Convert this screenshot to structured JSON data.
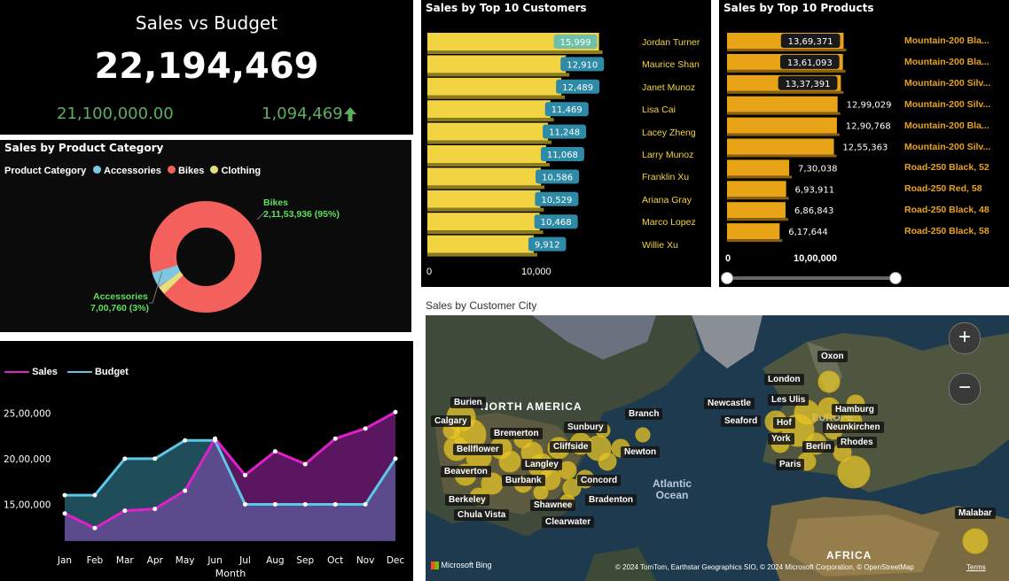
{
  "kpi": {
    "title": "Sales vs Budget",
    "value": "22,194,469",
    "budget": "21,100,000.00",
    "variance": "1,094,469",
    "variance_icon": "arrow-up-icon",
    "color_positive": "#5fae5f"
  },
  "category": {
    "title": "Sales by Product Category",
    "legend_title": "Product Category",
    "legend": [
      {
        "name": "Accessories",
        "color": "#7ec8e3"
      },
      {
        "name": "Bikes",
        "color": "#f4605c"
      },
      {
        "name": "Clothing",
        "color": "#e6e07a"
      }
    ],
    "bikes_label": "Bikes",
    "bikes_value": "2,11,53,936 (95%)",
    "acc_label": "Accessories",
    "acc_value": "7,00,760 (3%)"
  },
  "customers": {
    "title": "Sales by Top 10 Customers",
    "axis_0": "0",
    "axis_1": "10,000",
    "color": "#f2d342",
    "items": [
      {
        "name": "Jordan Turner",
        "label": "15,999"
      },
      {
        "name": "Maurice Shan",
        "label": "12,910"
      },
      {
        "name": "Janet Munoz",
        "label": "12,489"
      },
      {
        "name": "Lisa Cai",
        "label": "11,469"
      },
      {
        "name": "Lacey Zheng",
        "label": "11,248"
      },
      {
        "name": "Larry Munoz",
        "label": "11,068"
      },
      {
        "name": "Franklin Xu",
        "label": "10,586"
      },
      {
        "name": "Ariana Gray",
        "label": "10,529"
      },
      {
        "name": "Marco Lopez",
        "label": "10,468"
      },
      {
        "name": "Willie Xu",
        "label": "9,912"
      }
    ]
  },
  "products": {
    "title": "Sales by Top 10 Products",
    "axis_0": "0",
    "axis_1": "10,00,000",
    "color": "#e8a317",
    "items": [
      {
        "name": "Mountain-200 Bla...",
        "label": "13,69,371"
      },
      {
        "name": "Mountain-200 Bla...",
        "label": "13,61,093"
      },
      {
        "name": "Mountain-200 Silv...",
        "label": "13,37,391"
      },
      {
        "name": "Mountain-200 Silv...",
        "label": "12,99,029"
      },
      {
        "name": "Mountain-200 Bla...",
        "label": "12,90,768"
      },
      {
        "name": "Mountain-200 Silv...",
        "label": "12,55,363"
      },
      {
        "name": "Road-250 Black, 52",
        "label": "7,30,038"
      },
      {
        "name": "Road-250 Red, 58",
        "label": "6,93,911"
      },
      {
        "name": "Road-250 Black, 48",
        "label": "6,86,843"
      },
      {
        "name": "Road-250 Black, 58",
        "label": "6,17,644"
      }
    ]
  },
  "map": {
    "title": "Sales by Customer City",
    "continent_na": "NORTH AMERICA",
    "continent_eu": "EUROPE",
    "continent_af": "AFRICA",
    "ocean": "Atlantic\nOcean",
    "ocean_1": "Atlantic",
    "ocean_2": "Ocean",
    "bing": "Microsoft Bing",
    "attribution": "© 2024 TomTom, Earthstar Geographics SIO, © 2024 Microsoft Corporation, © OpenStreetMap",
    "terms": "Terms",
    "zoom_in": "+",
    "zoom_out": "−",
    "cities": [
      "Burien",
      "Calgary",
      "Bremerton",
      "Sunbury",
      "Branch",
      "Bellflower",
      "Cliffside",
      "Langley",
      "Newton",
      "Beaverton",
      "Burbank",
      "Concord",
      "Berkeley",
      "Shawnee",
      "Bradenton",
      "Chula Vista",
      "Clearwater",
      "London",
      "Newcastle",
      "Les Ulis",
      "Oxon",
      "Hamburg",
      "Seaford",
      "Hof",
      "Neunkirchen",
      "York",
      "Rhodes",
      "Berlin",
      "Paris",
      "Malabar"
    ]
  },
  "line": {
    "legend": [
      {
        "name": "Sales",
        "color": "#e020c8"
      },
      {
        "name": "Budget",
        "color": "#5bc8e8"
      }
    ],
    "ylabels": [
      "25,00,000",
      "20,00,000",
      "15,00,000"
    ],
    "xlabel": "Month"
  },
  "chart_data": {
    "type": "line",
    "x": [
      "Jan",
      "Feb",
      "Mar",
      "Apr",
      "May",
      "Jun",
      "Jul",
      "Aug",
      "Sep",
      "Oct",
      "Nov",
      "Dec"
    ],
    "series": [
      {
        "name": "Sales",
        "values": [
          1400000,
          1240000,
          1430000,
          1450000,
          1650000,
          2220000,
          1820000,
          2080000,
          1940000,
          2220000,
          2330000,
          2510000
        ]
      },
      {
        "name": "Budget",
        "values": [
          1600000,
          1600000,
          2000000,
          2000000,
          2200000,
          2200000,
          1500000,
          1500000,
          1500000,
          1500000,
          1500000,
          2000000
        ]
      }
    ],
    "xlabel": "Month",
    "ylabel": "",
    "ylim": [
      1100000,
      2600000
    ]
  }
}
